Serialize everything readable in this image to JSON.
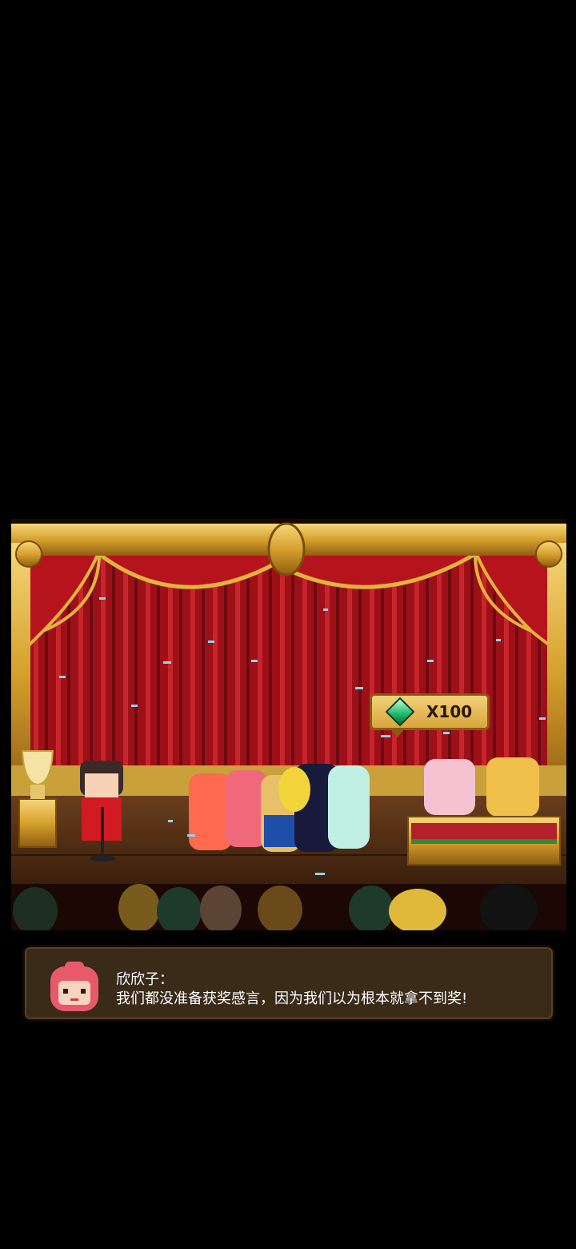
{
  "scene": {
    "reward": {
      "icon": "emerald-gem-icon",
      "label": "X100"
    }
  },
  "dialog": {
    "speaker": "欣欣子：",
    "text": "我们都没准备获奖感言，因为我们以为根本就拿不到奖!"
  },
  "colors": {
    "background": "#000000",
    "curtain": "#a5121a",
    "gold": "#e2b43c",
    "dialog_bg": "#3a2a18"
  }
}
